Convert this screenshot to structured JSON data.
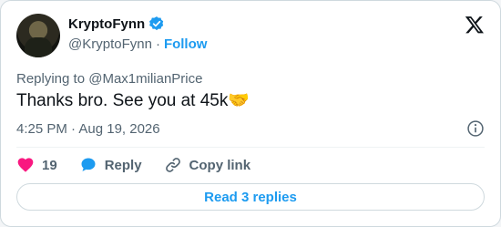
{
  "author": {
    "name": "KryptoFynn",
    "handle": "@KryptoFynn",
    "separator": "·",
    "follow_label": "Follow",
    "verified_color": "#1d9bf0"
  },
  "tweet": {
    "replying_prefix": "Replying to ",
    "replying_to": "@Max1milianPrice",
    "text": "Thanks bro. See you at 45k",
    "emoji": "🤝",
    "timestamp": "4:25 PM · Aug 19, 2026"
  },
  "actions": {
    "like_count": "19",
    "reply_label": "Reply",
    "copy_label": "Copy link"
  },
  "read_replies_label": "Read 3 replies",
  "icons": [
    "verified-badge-icon",
    "x-logo-icon",
    "info-icon",
    "heart-icon",
    "reply-bubble-icon",
    "link-icon"
  ],
  "colors": {
    "accent": "#1d9bf0",
    "like": "#f91880",
    "muted": "#536471"
  }
}
